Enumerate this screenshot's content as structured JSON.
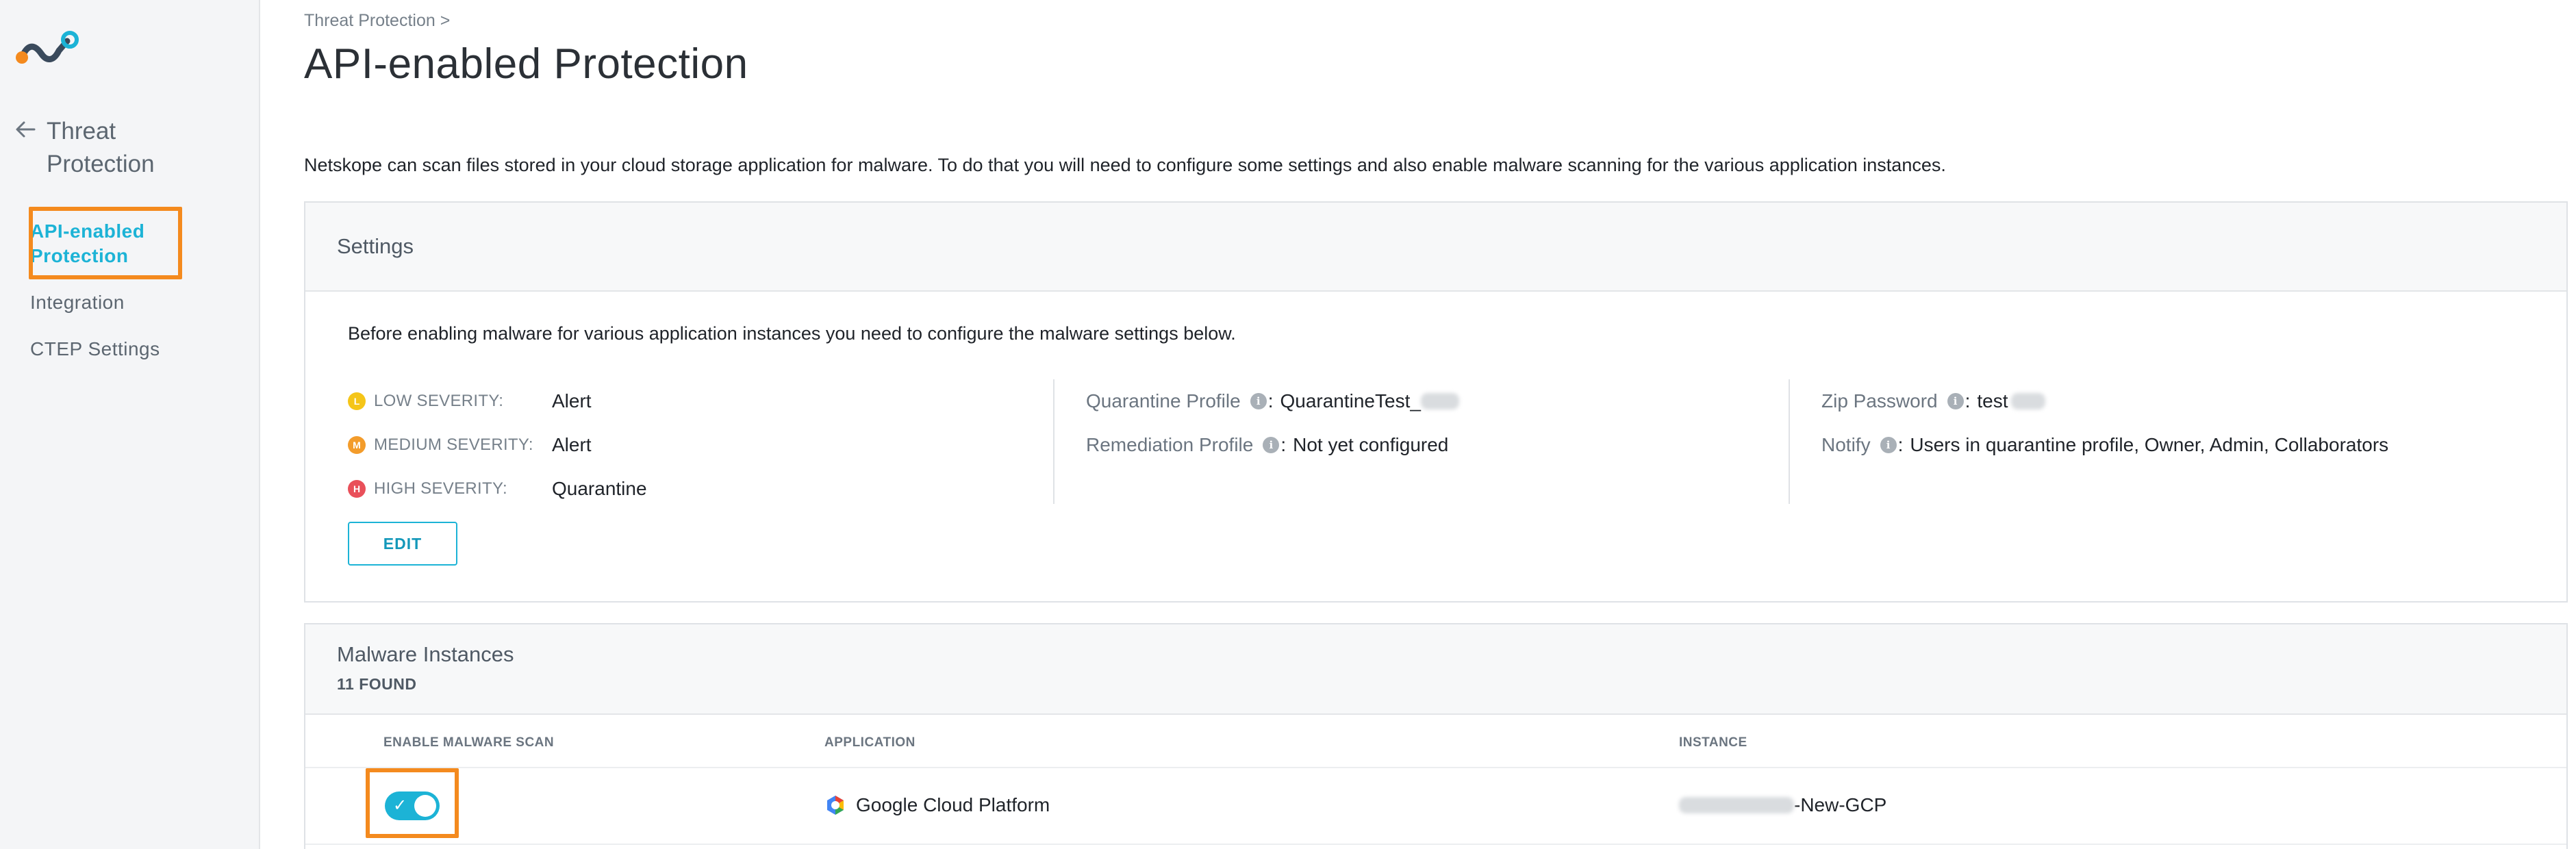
{
  "sidebar": {
    "section_title": "Threat Protection",
    "items": [
      {
        "label": "API-enabled Protection",
        "active": true
      },
      {
        "label": "Integration",
        "active": false
      },
      {
        "label": "CTEP Settings",
        "active": false
      }
    ]
  },
  "breadcrumb": "Threat Protection >",
  "page_title": "API-enabled Protection",
  "intro": "Netskope can scan files stored in your cloud storage application for malware. To do that you will need to configure some settings and also enable malware scanning for the various application instances.",
  "settings": {
    "title": "Settings",
    "description": "Before enabling malware for various application instances you need to configure the malware settings below.",
    "severities": [
      {
        "badge": "L",
        "label": "LOW SEVERITY:",
        "value": "Alert",
        "color": "#f5c518"
      },
      {
        "badge": "M",
        "label": "MEDIUM SEVERITY:",
        "value": "Alert",
        "color": "#f39c2b"
      },
      {
        "badge": "H",
        "label": "HIGH SEVERITY:",
        "value": "Quarantine",
        "color": "#e9505a"
      }
    ],
    "quarantine_profile": {
      "label": "Quarantine Profile",
      "value": "QuarantineTest_"
    },
    "remediation_profile": {
      "label": "Remediation Profile",
      "value": "Not yet configured"
    },
    "zip_password": {
      "label": "Zip Password",
      "value": "test"
    },
    "notify": {
      "label": "Notify",
      "value": "Users in quarantine profile, Owner, Admin, Collaborators"
    },
    "edit_label": "EDIT"
  },
  "instances": {
    "title": "Malware Instances",
    "count_label": "11 FOUND",
    "columns": {
      "enable": "ENABLE MALWARE SCAN",
      "application": "APPLICATION",
      "instance": "INSTANCE"
    },
    "rows": [
      {
        "enabled": true,
        "application": "Google Cloud Platform",
        "instance_suffix": "-New-GCP"
      }
    ]
  },
  "colors": {
    "accent": "#1cb3d6",
    "highlight": "#f48a1e"
  },
  "icons": [
    "netskope-logo-icon",
    "back-arrow-icon",
    "info-icon",
    "check-icon",
    "gcp-icon"
  ]
}
